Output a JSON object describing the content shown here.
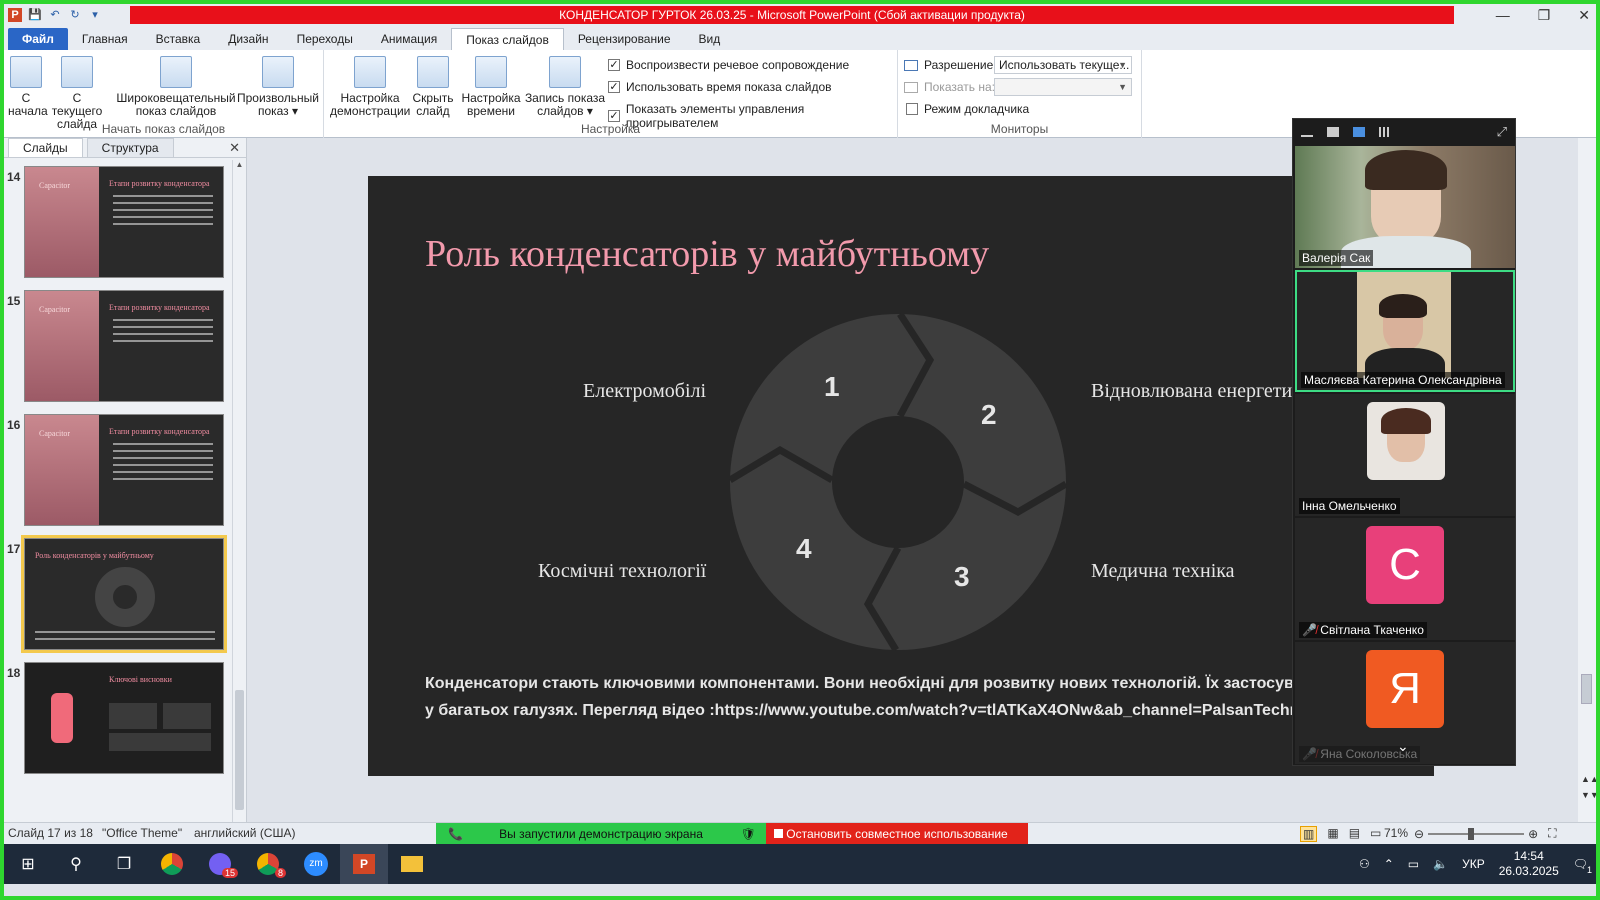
{
  "window": {
    "title": "КОНДЕНСАТОР ГУРТОК 26.03.25 -  Microsoft PowerPoint (Сбой активации продукта)",
    "controls": [
      "—",
      "❐",
      "✕"
    ]
  },
  "ribbon_tabs": [
    "Файл",
    "Главная",
    "Вставка",
    "Дизайн",
    "Переходы",
    "Анимация",
    "Показ слайдов",
    "Рецензирование",
    "Вид"
  ],
  "active_tab": "Показ слайдов",
  "ribbon": {
    "group_start": {
      "label": "Начать показ слайдов",
      "buttons": [
        {
          "line1": "С",
          "line2": "начала"
        },
        {
          "line1": "С текущего",
          "line2": "слайда"
        },
        {
          "line1": "Широковещательный",
          "line2": "показ слайдов"
        },
        {
          "line1": "Произвольный",
          "line2": "показ ▾"
        }
      ]
    },
    "group_setup": {
      "label": "Настройка",
      "buttons": [
        {
          "line1": "Настройка",
          "line2": "демонстрации"
        },
        {
          "line1": "Скрыть",
          "line2": "слайд"
        },
        {
          "line1": "Настройка",
          "line2": "времени"
        },
        {
          "line1": "Запись показа",
          "line2": "слайдов ▾"
        }
      ],
      "checks": [
        {
          "label": "Воспроизвести речевое сопровождение",
          "checked": true
        },
        {
          "label": "Использовать время показа слайдов",
          "checked": true
        },
        {
          "label": "Показать элементы управления проигрывателем",
          "checked": true
        }
      ]
    },
    "group_monitors": {
      "label": "Мониторы",
      "resolution_label": "Разрешение:",
      "resolution_value": "Использовать текуще...",
      "show_on_label": "Показать на:",
      "show_on_value": "",
      "presenter_label": "Режим докладчика",
      "presenter_checked": false
    }
  },
  "left_panel": {
    "tabs": [
      "Слайды",
      "Структура"
    ],
    "active_tab": "Слайды",
    "close": "✕",
    "thumbs": [
      {
        "num": "14",
        "title": "Етапи розвитку конденсатора",
        "left": "Capacitor"
      },
      {
        "num": "15",
        "title": "Етапи розвитку конденсатора",
        "left": "Capacitor"
      },
      {
        "num": "16",
        "title": "Етапи розвитку конденсатора",
        "left": "Capacitor"
      },
      {
        "num": "17",
        "title": "Роль конденсаторів у майбутньому",
        "left": ""
      },
      {
        "num": "18",
        "title": "Ключові висновки",
        "left": ""
      }
    ],
    "selected": "17"
  },
  "slide": {
    "title": "Роль конденсаторів у майбутньому",
    "labels": {
      "top_left": "Електромобілі",
      "top_right": "Відновлювана енергетика",
      "bottom_left": "Космічні технології",
      "bottom_right": "Медична техніка"
    },
    "segments": [
      "1",
      "2",
      "3",
      "4"
    ],
    "body_line1": "Конденсатори стають ключовими компонентами. Вони необхідні для розвитку нових технологій. Їх застосування розширюється",
    "body_line2": "у багатьох галузях. Перегляд відео :https://www.youtube.com/watch?v=tlATKaX4ONw&ab_channel=PalsanTechnology",
    "colors": {
      "background": "#262626",
      "title": "#f29aac",
      "segment": "#3d3d3d"
    }
  },
  "meeting": {
    "participants": [
      {
        "name": "Валерія Сак",
        "type": "video"
      },
      {
        "name": "Масляєва Катерина Олександрівна",
        "type": "video",
        "speaking": true
      },
      {
        "name": "Інна Омельченко",
        "type": "video"
      },
      {
        "name": "Світлана Ткаченко",
        "type": "letter",
        "letter": "С",
        "color": "#e8407a",
        "muted": true
      },
      {
        "name": "Яна Соколовська",
        "type": "letter",
        "letter": "Я",
        "color": "#f05a22",
        "muted": true
      }
    ]
  },
  "status": {
    "slide_info": "Слайд 17 из 18",
    "theme": "\"Office Theme\"",
    "language": "английский (США)",
    "share_text": "Вы запустили демонстрацию экрана",
    "stop_text": "Остановить совместное использование",
    "zoom": "71%"
  },
  "taskbar": {
    "lang": "УКР",
    "time": "14:54",
    "date": "26.03.2025",
    "badge_viber": "15",
    "badge_chrome": "8",
    "notif": "1"
  }
}
